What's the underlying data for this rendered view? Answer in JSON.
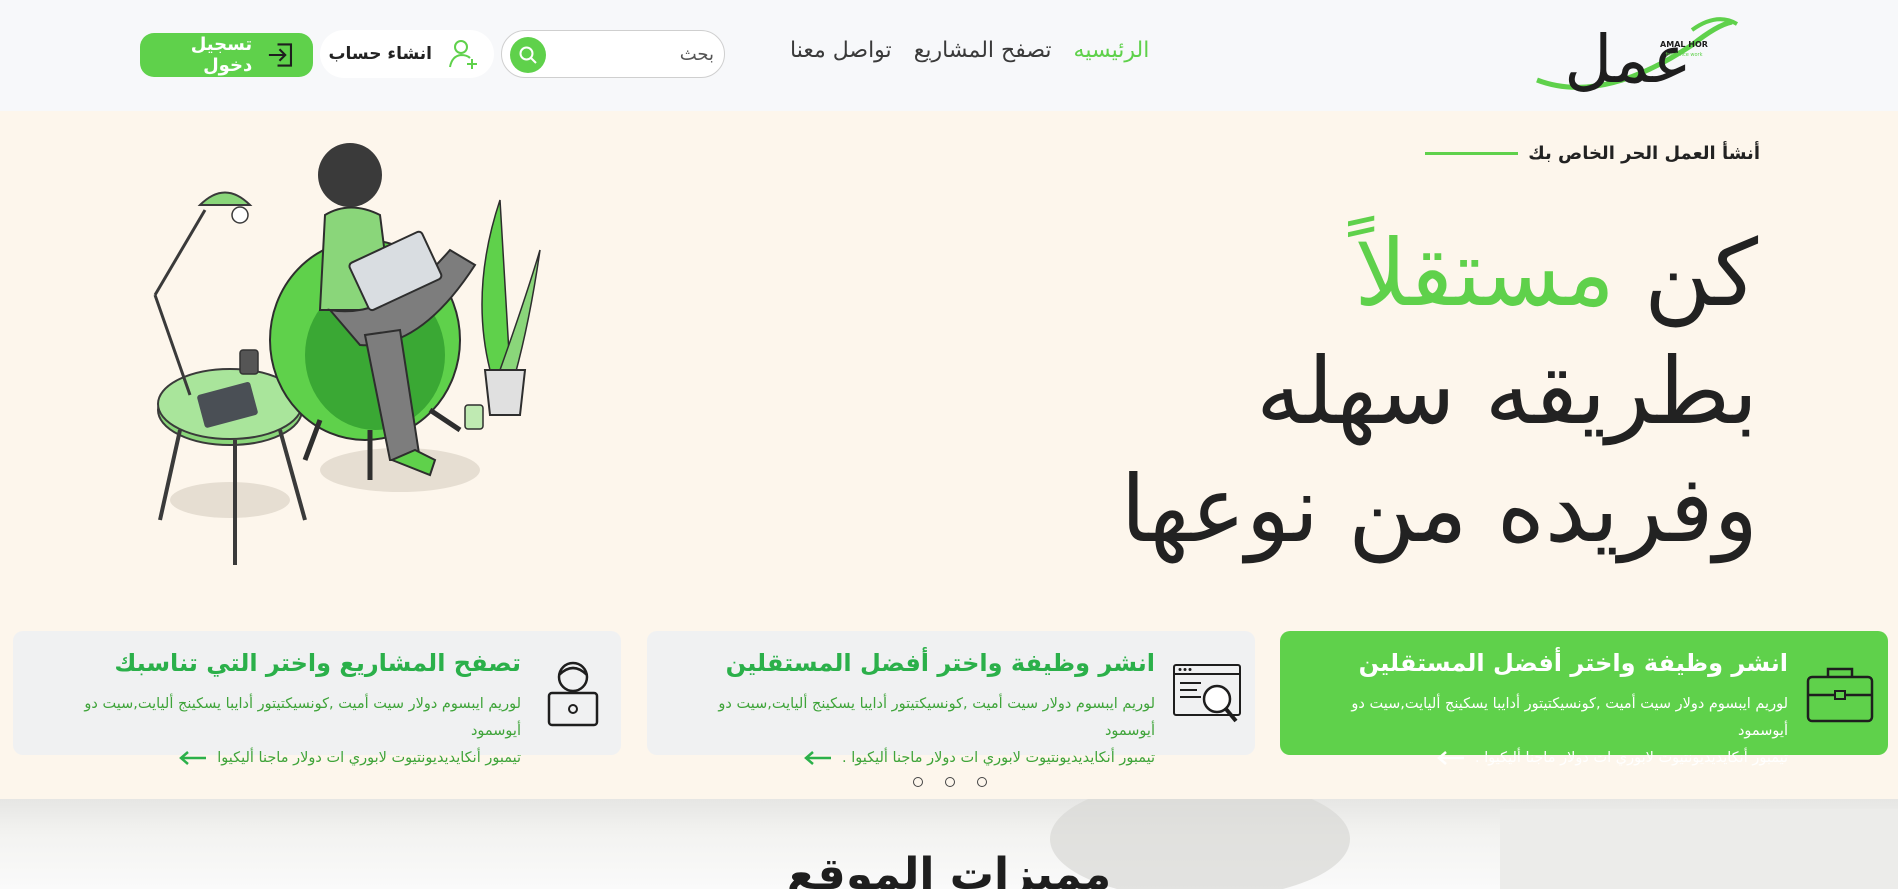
{
  "brand": {
    "logo_text": "عمل",
    "logo_sub": "AMAL HOR",
    "logo_tagline": "freelance work",
    "accent_color": "#5fd14b"
  },
  "nav": {
    "items": [
      {
        "label": "الرئيسيه",
        "active": true
      },
      {
        "label": "تصفح المشاريع",
        "active": false
      },
      {
        "label": "تواصل معنا",
        "active": false
      }
    ]
  },
  "search": {
    "placeholder": "بحث",
    "icon": "search-icon"
  },
  "signup": {
    "label": "انشاء حساب",
    "icon": "add-user-icon"
  },
  "login": {
    "label": "تسجيل دخول",
    "icon": "login-icon"
  },
  "hero": {
    "eyebrow": "أنشأ العمل الحر الخاص بك",
    "line1_plain": "كن",
    "line1_accent": "مستقلاً",
    "line2": "بطريقه سهله",
    "line3": "وفريده من نوعها"
  },
  "cards": [
    {
      "title": "انشر وظيفة واختر أفضل المستقلين",
      "desc_line1": "لوريم ايبسوم دولار سيت أميت ,كونسيكتيتور أدايبا يسكينج أليايت,سيت دو أيوسمود",
      "desc_line2": "تيمبور أنكايديديونتيوت لابوري ات دولار ماجنا أليكيوا .",
      "icon": "briefcase-icon",
      "highlighted": true
    },
    {
      "title": "انشر وظيفة واختر أفضل المستقلين",
      "desc_line1": "لوريم ايبسوم دولار سيت أميت ,كونسيكتيتور أدايبا يسكينج أليايت,سيت دو أيوسمود",
      "desc_line2": "تيمبور أنكايديديونتيوت لابوري ات دولار ماجنا أليكيوا .",
      "icon": "web-search-icon",
      "highlighted": false
    },
    {
      "title": "تصفح المشاريع واختر التي تناسبك",
      "desc_line1": "لوريم ايبسوم دولار سيت أميت ,كونسيكتيتور أدايبا يسكينج أليايت,سيت دو أيوسمود",
      "desc_line2": "تيمبور أنكايديديونتيوت لابوري ات دولار ماجنا أليكيوا",
      "icon": "freelancer-laptop-icon",
      "highlighted": false
    }
  ],
  "carousel": {
    "dots": 3
  },
  "features": {
    "title": "مميزات الموقع"
  }
}
